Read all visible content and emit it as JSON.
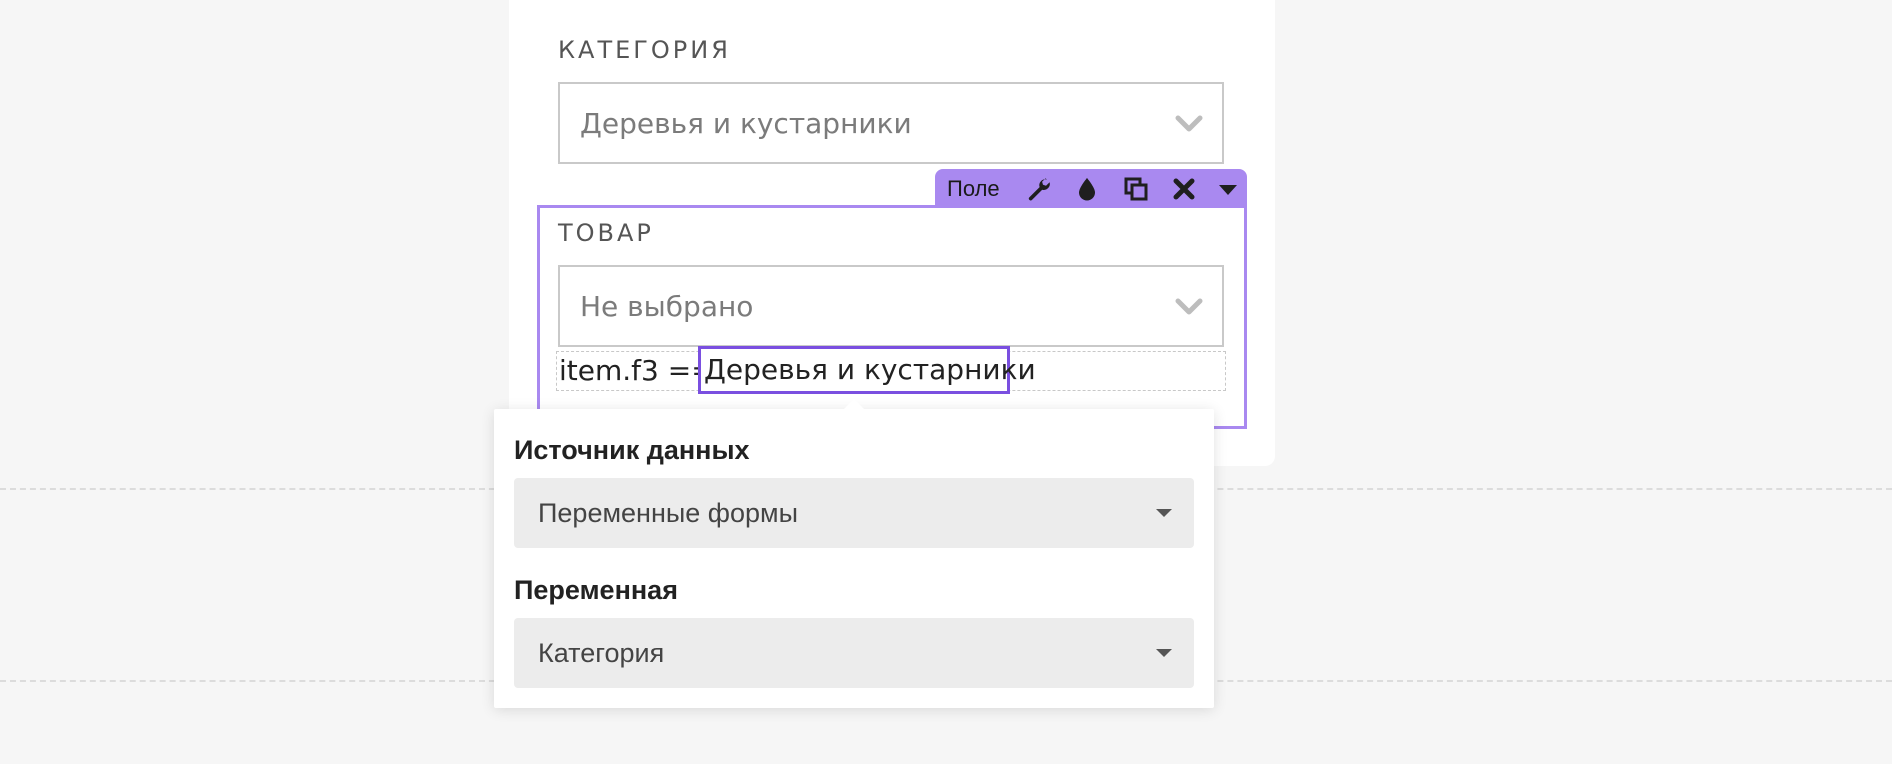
{
  "form": {
    "category_label": "КАТЕГОРИЯ",
    "category_value": "Деревья и кустарники",
    "product_label": "ТОВАР",
    "product_value": "Не выбрано"
  },
  "toolbar": {
    "label": "Поле",
    "icons": [
      "wrench-icon",
      "drop-icon",
      "copy-icon",
      "close-icon",
      "caret-down-icon"
    ],
    "color": "#a989f0"
  },
  "condition": {
    "expression": "item.f3 ==",
    "value": "Деревья и кустарники",
    "highlight_color": "#7a4fe0"
  },
  "popover": {
    "source_label": "Источник данных",
    "source_value": "Переменные формы",
    "variable_label": "Переменная",
    "variable_value": "Категория"
  }
}
